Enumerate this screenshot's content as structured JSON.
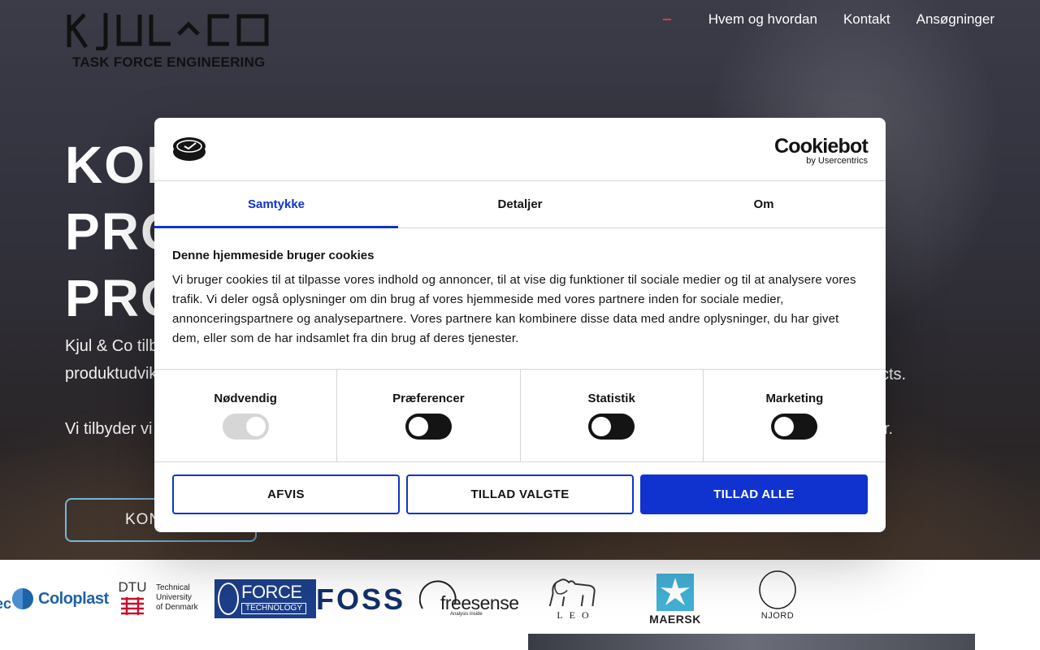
{
  "header": {
    "logo_text": "KJUL^CO",
    "tagline": "TASK FORCE ENGINEERING",
    "nav": [
      {
        "label": "Hvem og hvordan"
      },
      {
        "label": "Kontakt"
      },
      {
        "label": "Ansøgninger"
      }
    ]
  },
  "hero": {
    "heading_lines": [
      "KON",
      "PRO",
      "PRO"
    ],
    "paragraph1_line1": "Kjul & Co tilb",
    "paragraph1_line2": "produktudvik",
    "paragraph1_tail": "cts.",
    "paragraph2": "Vi tilbyder vi",
    "paragraph2_tail": "r.",
    "cta_label": "KON"
  },
  "clients": [
    {
      "name": "ec"
    },
    {
      "name": "Coloplast"
    },
    {
      "name": "DTU",
      "sub": [
        "Technical",
        "University",
        "of Denmark"
      ]
    },
    {
      "name": "FORCE",
      "sub": "TECHNOLOGY"
    },
    {
      "name": "FOSS"
    },
    {
      "name": "freesense",
      "sub": "Analysis inside"
    },
    {
      "name": "LEO"
    },
    {
      "name": "MAERSK"
    },
    {
      "name": "NJORD"
    }
  ],
  "cookie_dialog": {
    "brand": "Cookiebot",
    "brand_sub": "by Usercentrics",
    "tabs": [
      {
        "label": "Samtykke",
        "active": true
      },
      {
        "label": "Detaljer",
        "active": false
      },
      {
        "label": "Om",
        "active": false
      }
    ],
    "title": "Denne hjemmeside bruger cookies",
    "text": "Vi bruger cookies til at tilpasse vores indhold og annoncer, til at vise dig funktioner til sociale medier og til at analysere vores trafik. Vi deler også oplysninger om din brug af vores hjemmeside med vores partnere inden for sociale medier, annonceringspartnere og analysepartnere. Vores partnere kan kombinere disse data med andre oplysninger, du har givet dem, eller som de har indsamlet fra din brug af deres tjenester.",
    "categories": [
      {
        "label": "Nødvendig",
        "checked": true,
        "disabled": true
      },
      {
        "label": "Præferencer",
        "checked": false,
        "disabled": false
      },
      {
        "label": "Statistik",
        "checked": false,
        "disabled": false
      },
      {
        "label": "Marketing",
        "checked": false,
        "disabled": false
      }
    ],
    "buttons": {
      "reject": "AFVIS",
      "allow_selected": "TILLAD VALGTE",
      "allow_all": "TILLAD ALLE"
    }
  },
  "colors": {
    "accent": "#1032cf",
    "heading_blue": "#1f4d85",
    "nav_indicator": "#d83a4a"
  }
}
